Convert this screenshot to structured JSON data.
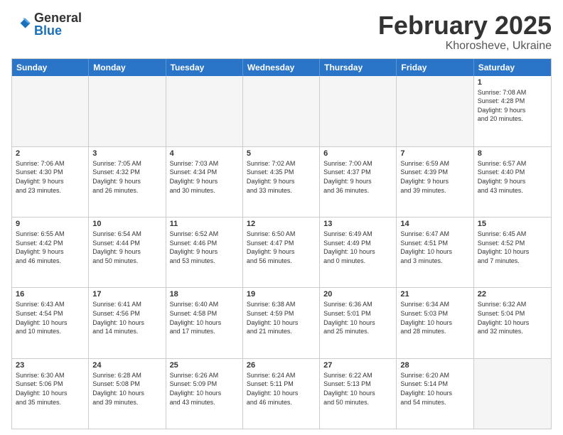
{
  "logo": {
    "general": "General",
    "blue": "Blue"
  },
  "title": {
    "month": "February 2025",
    "location": "Khorosheve, Ukraine"
  },
  "header": {
    "days": [
      "Sunday",
      "Monday",
      "Tuesday",
      "Wednesday",
      "Thursday",
      "Friday",
      "Saturday"
    ]
  },
  "weeks": [
    [
      {
        "day": "",
        "info": "",
        "empty": true
      },
      {
        "day": "",
        "info": "",
        "empty": true
      },
      {
        "day": "",
        "info": "",
        "empty": true
      },
      {
        "day": "",
        "info": "",
        "empty": true
      },
      {
        "day": "",
        "info": "",
        "empty": true
      },
      {
        "day": "",
        "info": "",
        "empty": true
      },
      {
        "day": "1",
        "info": "Sunrise: 7:08 AM\nSunset: 4:28 PM\nDaylight: 9 hours\nand 20 minutes.",
        "empty": false
      }
    ],
    [
      {
        "day": "2",
        "info": "Sunrise: 7:06 AM\nSunset: 4:30 PM\nDaylight: 9 hours\nand 23 minutes.",
        "empty": false
      },
      {
        "day": "3",
        "info": "Sunrise: 7:05 AM\nSunset: 4:32 PM\nDaylight: 9 hours\nand 26 minutes.",
        "empty": false
      },
      {
        "day": "4",
        "info": "Sunrise: 7:03 AM\nSunset: 4:34 PM\nDaylight: 9 hours\nand 30 minutes.",
        "empty": false
      },
      {
        "day": "5",
        "info": "Sunrise: 7:02 AM\nSunset: 4:35 PM\nDaylight: 9 hours\nand 33 minutes.",
        "empty": false
      },
      {
        "day": "6",
        "info": "Sunrise: 7:00 AM\nSunset: 4:37 PM\nDaylight: 9 hours\nand 36 minutes.",
        "empty": false
      },
      {
        "day": "7",
        "info": "Sunrise: 6:59 AM\nSunset: 4:39 PM\nDaylight: 9 hours\nand 39 minutes.",
        "empty": false
      },
      {
        "day": "8",
        "info": "Sunrise: 6:57 AM\nSunset: 4:40 PM\nDaylight: 9 hours\nand 43 minutes.",
        "empty": false
      }
    ],
    [
      {
        "day": "9",
        "info": "Sunrise: 6:55 AM\nSunset: 4:42 PM\nDaylight: 9 hours\nand 46 minutes.",
        "empty": false
      },
      {
        "day": "10",
        "info": "Sunrise: 6:54 AM\nSunset: 4:44 PM\nDaylight: 9 hours\nand 50 minutes.",
        "empty": false
      },
      {
        "day": "11",
        "info": "Sunrise: 6:52 AM\nSunset: 4:46 PM\nDaylight: 9 hours\nand 53 minutes.",
        "empty": false
      },
      {
        "day": "12",
        "info": "Sunrise: 6:50 AM\nSunset: 4:47 PM\nDaylight: 9 hours\nand 56 minutes.",
        "empty": false
      },
      {
        "day": "13",
        "info": "Sunrise: 6:49 AM\nSunset: 4:49 PM\nDaylight: 10 hours\nand 0 minutes.",
        "empty": false
      },
      {
        "day": "14",
        "info": "Sunrise: 6:47 AM\nSunset: 4:51 PM\nDaylight: 10 hours\nand 3 minutes.",
        "empty": false
      },
      {
        "day": "15",
        "info": "Sunrise: 6:45 AM\nSunset: 4:52 PM\nDaylight: 10 hours\nand 7 minutes.",
        "empty": false
      }
    ],
    [
      {
        "day": "16",
        "info": "Sunrise: 6:43 AM\nSunset: 4:54 PM\nDaylight: 10 hours\nand 10 minutes.",
        "empty": false
      },
      {
        "day": "17",
        "info": "Sunrise: 6:41 AM\nSunset: 4:56 PM\nDaylight: 10 hours\nand 14 minutes.",
        "empty": false
      },
      {
        "day": "18",
        "info": "Sunrise: 6:40 AM\nSunset: 4:58 PM\nDaylight: 10 hours\nand 17 minutes.",
        "empty": false
      },
      {
        "day": "19",
        "info": "Sunrise: 6:38 AM\nSunset: 4:59 PM\nDaylight: 10 hours\nand 21 minutes.",
        "empty": false
      },
      {
        "day": "20",
        "info": "Sunrise: 6:36 AM\nSunset: 5:01 PM\nDaylight: 10 hours\nand 25 minutes.",
        "empty": false
      },
      {
        "day": "21",
        "info": "Sunrise: 6:34 AM\nSunset: 5:03 PM\nDaylight: 10 hours\nand 28 minutes.",
        "empty": false
      },
      {
        "day": "22",
        "info": "Sunrise: 6:32 AM\nSunset: 5:04 PM\nDaylight: 10 hours\nand 32 minutes.",
        "empty": false
      }
    ],
    [
      {
        "day": "23",
        "info": "Sunrise: 6:30 AM\nSunset: 5:06 PM\nDaylight: 10 hours\nand 35 minutes.",
        "empty": false
      },
      {
        "day": "24",
        "info": "Sunrise: 6:28 AM\nSunset: 5:08 PM\nDaylight: 10 hours\nand 39 minutes.",
        "empty": false
      },
      {
        "day": "25",
        "info": "Sunrise: 6:26 AM\nSunset: 5:09 PM\nDaylight: 10 hours\nand 43 minutes.",
        "empty": false
      },
      {
        "day": "26",
        "info": "Sunrise: 6:24 AM\nSunset: 5:11 PM\nDaylight: 10 hours\nand 46 minutes.",
        "empty": false
      },
      {
        "day": "27",
        "info": "Sunrise: 6:22 AM\nSunset: 5:13 PM\nDaylight: 10 hours\nand 50 minutes.",
        "empty": false
      },
      {
        "day": "28",
        "info": "Sunrise: 6:20 AM\nSunset: 5:14 PM\nDaylight: 10 hours\nand 54 minutes.",
        "empty": false
      },
      {
        "day": "",
        "info": "",
        "empty": true
      }
    ]
  ]
}
